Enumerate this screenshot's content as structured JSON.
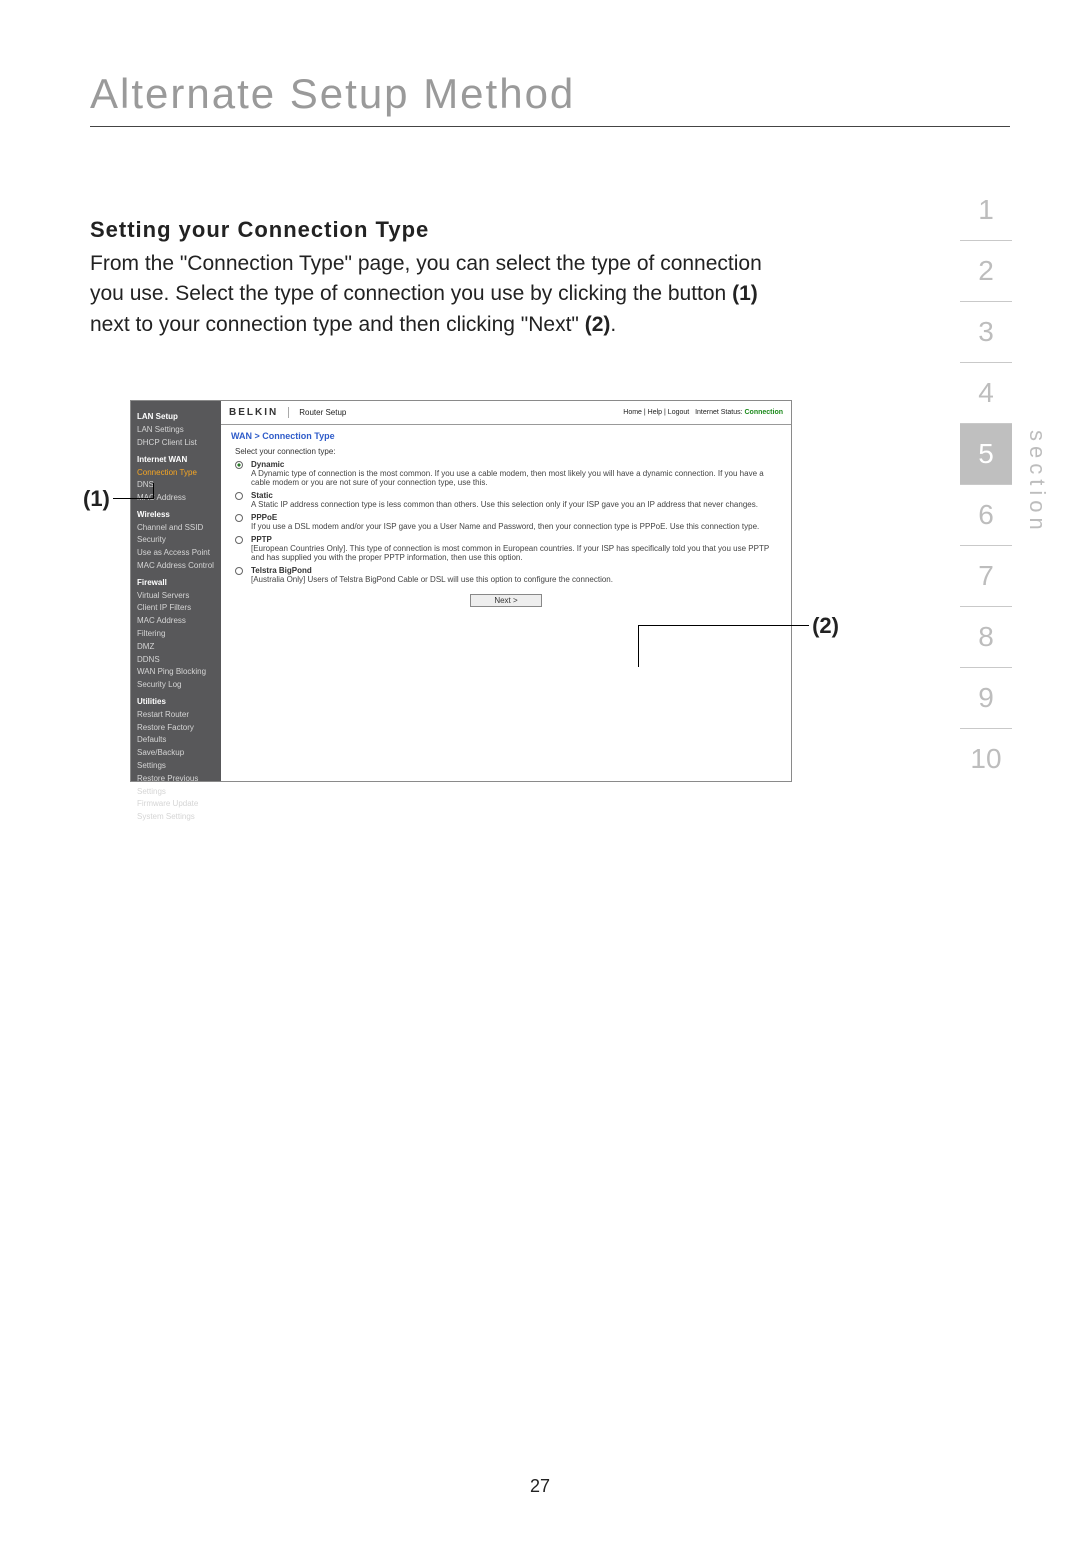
{
  "page_title": "Alternate Setup Method",
  "heading": "Setting your Connection Type",
  "body_parts": {
    "p1": "From the \"Connection Type\" page, you can select the type of connection you use. Select the type of connection you use by clicking the button ",
    "b1": "(1)",
    "p2": " next to your connection type and then clicking \"Next\" ",
    "b2": "(2)",
    "p3": "."
  },
  "section_label": "section",
  "section_numbers": [
    "1",
    "2",
    "3",
    "4",
    "5",
    "6",
    "7",
    "8",
    "9",
    "10"
  ],
  "active_section": "5",
  "page_number": "27",
  "callouts": {
    "one": "(1)",
    "two": "(2)"
  },
  "screenshot": {
    "brand": "BELKIN",
    "router_setup": "Router Setup",
    "top_links": {
      "home": "Home",
      "help": "Help",
      "logout": "Logout",
      "status_label": "Internet Status:",
      "status_value": "Connection"
    },
    "breadcrumb": "WAN > Connection Type",
    "prompt": "Select your connection type:",
    "options": [
      {
        "name": "Dynamic",
        "desc": "A Dynamic type of connection is the most common. If you use a cable modem, then most likely you will have a dynamic connection. If you have a cable modem or you are not sure of your connection type, use this.",
        "selected": true
      },
      {
        "name": "Static",
        "desc": "A Static IP address connection type is less common than others. Use this selection only if your ISP gave you an IP address that never changes.",
        "selected": false
      },
      {
        "name": "PPPoE",
        "desc": "If you use a DSL modem and/or your ISP gave you a User Name and Password, then your connection type is PPPoE. Use this connection type.",
        "selected": false
      },
      {
        "name": "PPTP",
        "desc": "[European Countries Only]. This type of connection is most common in European countries. If your ISP has specifically told you that you use PPTP and has supplied you with the proper PPTP information, then use this option.",
        "selected": false
      },
      {
        "name": "Telstra BigPond",
        "desc": "[Australia Only] Users of Telstra BigPond Cable or DSL will use this option to configure the connection.",
        "selected": false
      }
    ],
    "next_label": "Next >",
    "sidebar": {
      "groups": [
        {
          "title": "LAN Setup",
          "items": [
            "LAN Settings",
            "DHCP Client List"
          ]
        },
        {
          "title": "Internet WAN",
          "items": [
            "Connection Type",
            "DNS",
            "MAC Address"
          ],
          "highlight": 0
        },
        {
          "title": "Wireless",
          "items": [
            "Channel and SSID",
            "Security",
            "Use as Access Point",
            "MAC Address Control"
          ]
        },
        {
          "title": "Firewall",
          "items": [
            "Virtual Servers",
            "Client IP Filters",
            "MAC Address Filtering",
            "DMZ",
            "DDNS",
            "WAN Ping Blocking",
            "Security Log"
          ]
        },
        {
          "title": "Utilities",
          "items": [
            "Restart Router",
            "Restore Factory Defaults",
            "Save/Backup Settings",
            "Restore Previous Settings",
            "Firmware Update",
            "System Settings"
          ]
        }
      ]
    }
  }
}
